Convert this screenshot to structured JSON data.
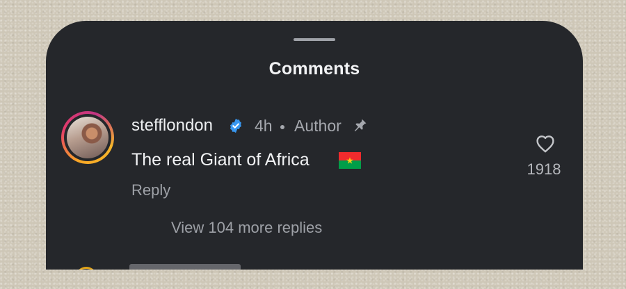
{
  "sheet": {
    "title": "Comments"
  },
  "comment": {
    "username": "stefflondon",
    "verified_icon": "verified-badge-icon",
    "time": "4h",
    "author_label": "Author",
    "pinned_icon": "pin-icon",
    "text": "The real Giant of Africa",
    "flag_icon": "burkina-faso-flag-icon",
    "reply_label": "Reply",
    "like_icon": "heart-outline-icon",
    "like_count": "1918",
    "view_more_replies": "View 104 more replies"
  },
  "colors": {
    "sheet_background": "#25272b",
    "page_background": "#cec7b7",
    "primary_text": "#f2f3f5",
    "secondary_text": "#a5a8ae",
    "verified_blue": "#3897f0",
    "story_ring_start": "#f9a825",
    "story_ring_end": "#c13584"
  }
}
